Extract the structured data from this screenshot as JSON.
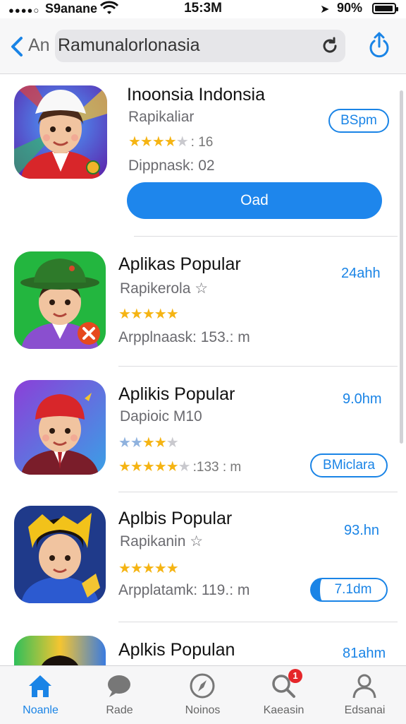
{
  "status_bar": {
    "signal": "●●●●○",
    "carrier": "S9anane",
    "time": "15:3M",
    "battery": "90%"
  },
  "nav": {
    "back_label": "An",
    "search_text": "Ramunalorlonasia"
  },
  "apps": [
    {
      "name": "Inoonsia Indonsia",
      "subtitle": "Rapikaliar",
      "rating": 4,
      "reviews": ": 16",
      "meta": "Dippnask: 02",
      "action": "BSpm",
      "get_label": "Oad"
    },
    {
      "name": "Aplikas Popular",
      "subtitle": "Rapikerola ☆",
      "rating": 5,
      "meta": "Arpplnaask: 153.: m",
      "size": "24ahh"
    },
    {
      "name": "Aplikis Popular",
      "subtitle": "Dapioic M10",
      "rating": 4,
      "reviews": ":133 : m",
      "size": "9.0hm",
      "action": "BMiclara"
    },
    {
      "name": "Aplbis Popular",
      "subtitle": "Rapikanin ☆",
      "rating": 5,
      "meta": "Arpplatamk: 119.: m",
      "size": "93.hn",
      "action": "7.1dm"
    },
    {
      "name": "Aplkis Populan",
      "size": "81ahm"
    }
  ],
  "tabs": [
    {
      "label": "Noanle",
      "icon": "home-icon"
    },
    {
      "label": "Rade",
      "icon": "chat-icon"
    },
    {
      "label": "Noinos",
      "icon": "compass-icon"
    },
    {
      "label": "Kaeasin",
      "icon": "search-icon",
      "badge": "1"
    },
    {
      "label": "Edsanai",
      "icon": "person-icon"
    }
  ],
  "colors": {
    "accent": "#1a84e6",
    "star": "#f5b413",
    "badge": "#e5262a"
  }
}
